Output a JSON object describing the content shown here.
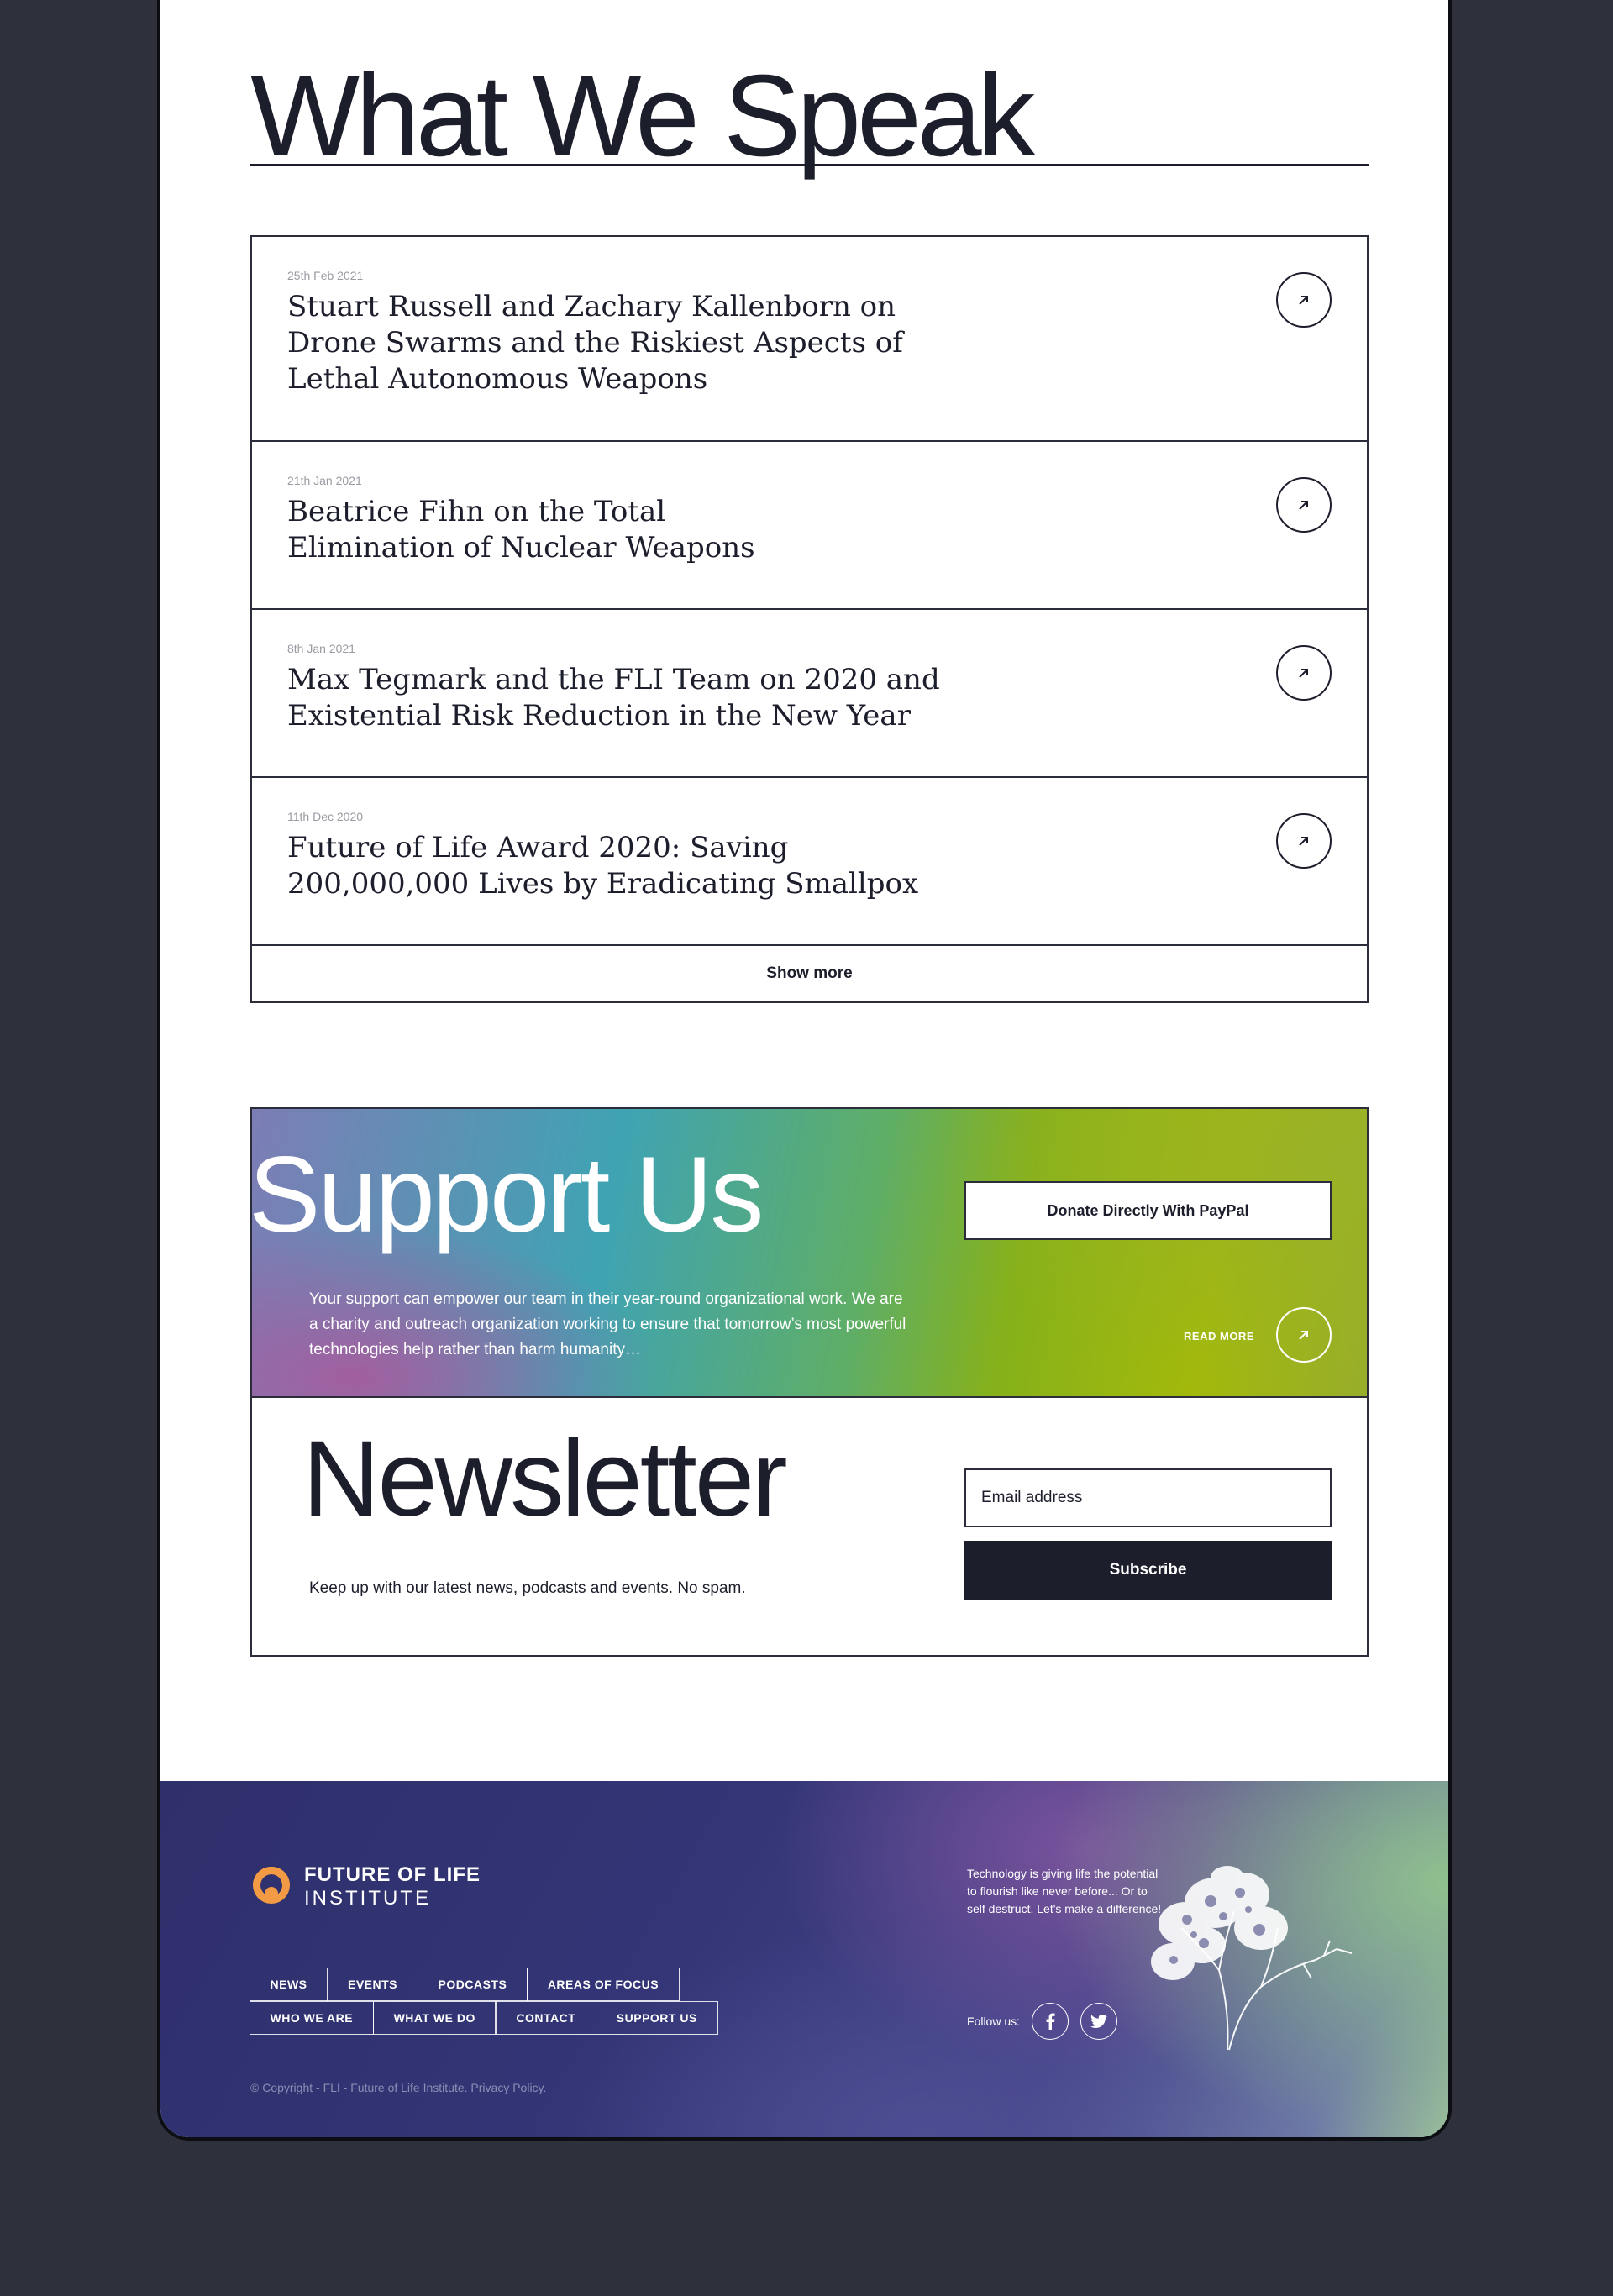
{
  "speak": {
    "title": "What We Speak",
    "articles": [
      {
        "date": "25th Feb 2021",
        "title": "Stuart Russell and Zachary Kallenborn on Drone Swarms and the Riskiest Aspects of Lethal Autonomous Weapons"
      },
      {
        "date": "21th Jan 2021",
        "title": "Beatrice Fihn on the Total Elimination of Nuclear Weapons"
      },
      {
        "date": "8th Jan 2021",
        "title": "Max Tegmark and the FLI Team on 2020 and Existential Risk Reduction in the New Year"
      },
      {
        "date": "11th Dec 2020",
        "title": "Future of Life Award 2020: Saving 200,000,000 Lives by Eradicating Smallpox"
      }
    ],
    "show_more": "Show more"
  },
  "support": {
    "title": "Support Us",
    "description": "Your support can empower our team in their year-round organizational work. We are a charity and outreach organization working to ensure that tomorrow’s most powerful technologies help rather than harm humanity…",
    "paypal_label": "Donate Directly With PayPal",
    "read_more": "READ MORE"
  },
  "newsletter": {
    "title": "Newsletter",
    "description": "Keep up with our latest news, podcasts and events. No spam.",
    "email_placeholder": "Email address",
    "subscribe_label": "Subscribe"
  },
  "footer": {
    "logo_line1": "FUTURE OF LIFE",
    "logo_line2": "INSTITUTE",
    "nav_row1": [
      "NEWS",
      "EVENTS",
      "PODCASTS",
      "AREAS OF FOCUS"
    ],
    "nav_row2": [
      "WHO WE ARE",
      "WHAT WE DO",
      "CONTACT",
      "SUPPORT US"
    ],
    "tagline": "Technology is giving life the potential to flourish like never before... Or to self destruct. Let's make a difference!",
    "follow_label": "Follow us:",
    "social": [
      "facebook-icon",
      "twitter-icon"
    ],
    "copyright": "© Copyright - FLI - Future of Life Institute. Privacy Policy."
  },
  "colors": {
    "page_bg": "#2e303c",
    "ink": "#1d1e2c",
    "logo_orange": "#f39a45",
    "footer_base": "#333576"
  }
}
